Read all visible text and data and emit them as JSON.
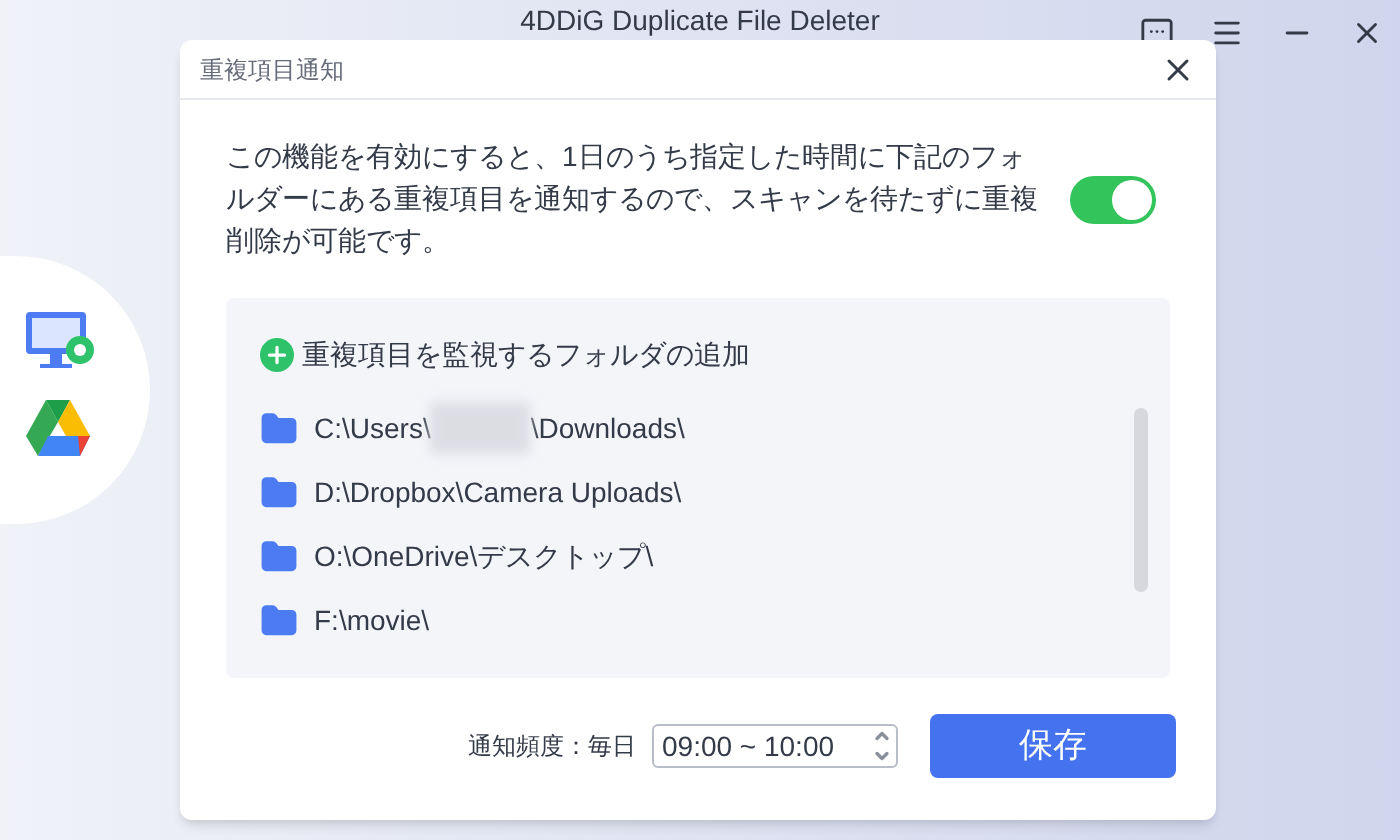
{
  "app": {
    "title": "4DDiG Duplicate File Deleter"
  },
  "dialog": {
    "title": "重複項目通知",
    "description": "この機能を有効にすると、1日のうち指定した時間に下記のフォルダーにある重複項目を通知するので、スキャンを待たずに重複削除が可能です。",
    "enabled": {
      "on": true
    },
    "add_folder": "重複項目を監視するフォルダの追加",
    "folders": [
      {
        "path_start": "C:\\Users\\",
        "redacted": true,
        "path_end": "\\Downloads\\"
      },
      {
        "path_start": "D:\\Dropbox\\Camera Uploads\\",
        "redacted": false
      },
      {
        "path_start": "O:\\OneDrive\\デスクトップ\\",
        "redacted": false
      },
      {
        "path_start": "F:\\movie\\",
        "redacted": false
      }
    ],
    "frequency_label": "通知頻度：毎日",
    "time_range": "09:00 ~ 10:00",
    "save": "保存"
  }
}
